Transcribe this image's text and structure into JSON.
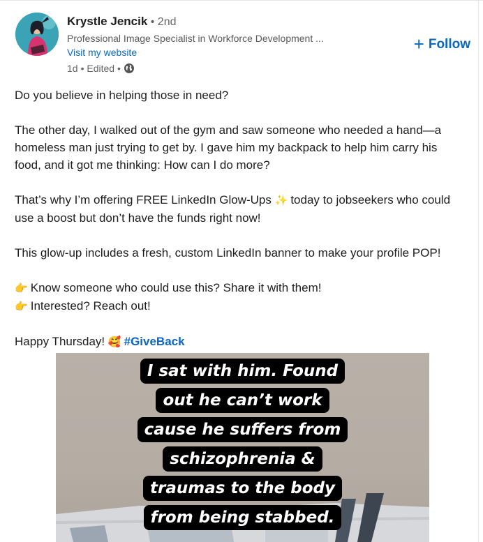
{
  "author": {
    "name": "Krystle Jencik",
    "degree": "• 2nd",
    "headline": "Professional Image Specialist in Workforce Development ...",
    "website_label": "Visit my website",
    "meta_time": "1d",
    "meta_edited": "• Edited •",
    "visibility_icon": "globe-icon"
  },
  "follow": {
    "icon": "plus-icon",
    "label": "Follow",
    "color": "#0a66c2"
  },
  "post": {
    "lines": [
      "Do you believe in helping those in need?",
      "The other day, I walked out of the gym and saw someone who needed a hand—a",
      "homeless man just trying to get by. I gave him my backpack to help him carry his",
      "food, and it got me thinking: How can I do more?",
      "That’s why I’m offering FREE LinkedIn Glow-Ups",
      "today to jobseekers who could",
      "use a boost but don’t have the funds right now!",
      "This glow-up includes a fresh, custom LinkedIn banner to make your profile POP!",
      "Know someone who could use this? Share it with them!",
      "Interested? Reach out!",
      "Happy Thursday!",
      "#GiveBack"
    ],
    "emoji_sparkles": "✨",
    "emoji_point": "👉",
    "emoji_hearts": "🥰"
  },
  "image": {
    "caption_lines": [
      "I sat with him. Found",
      "out he can’t work",
      "cause he suffers from",
      "schizophrenia &",
      "traumas to the body",
      "from being stabbed."
    ]
  }
}
